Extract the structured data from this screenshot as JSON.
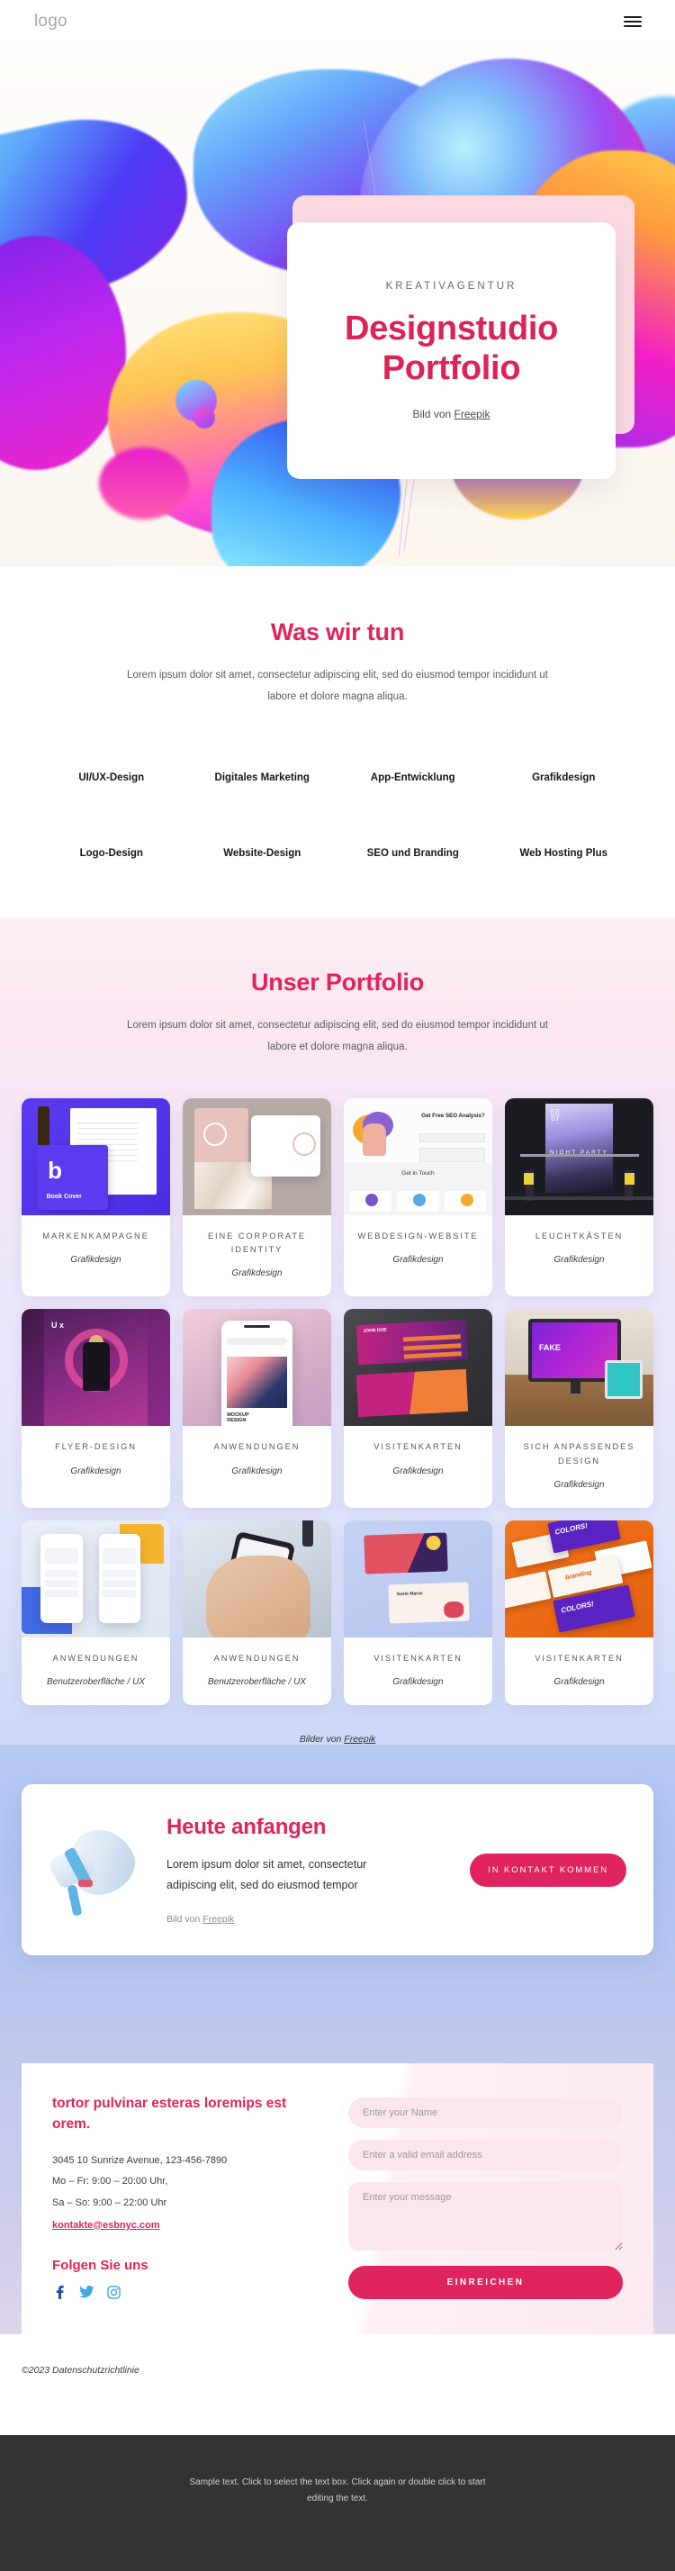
{
  "header": {
    "logo": "logo",
    "menu_icon": "hamburger-icon"
  },
  "hero": {
    "eyebrow": "KREATIVAGENTUR",
    "title_line1": "Designstudio",
    "title_line2": "Portfolio",
    "credit_prefix": "Bild von ",
    "credit_link": "Freepik"
  },
  "services": {
    "title": "Was wir tun",
    "subtitle": "Lorem ipsum dolor sit amet, consectetur adipiscing elit, sed do eiusmod tempor incididunt ut labore et dolore magna aliqua.",
    "items": [
      "UI/UX-Design",
      "Digitales Marketing",
      "App-Entwicklung",
      "Grafikdesign",
      "Logo-Design",
      "Website-Design",
      "SEO und Branding",
      "Web Hosting Plus"
    ]
  },
  "portfolio": {
    "title": "Unser Portfolio",
    "subtitle": "Lorem ipsum dolor sit amet, consectetur adipiscing elit, sed do eiusmod tempor incididunt ut labore et dolore magna aliqua.",
    "credit_prefix": "Bilder von ",
    "credit_link": "Freepik",
    "items": [
      {
        "title": "MARKENKAMPAGNE",
        "category": "Grafikdesign",
        "art": "t-brand"
      },
      {
        "title": "EINE CORPORATE IDENTITY",
        "category": "Grafikdesign",
        "art": "t-ci"
      },
      {
        "title": "WEBDESIGN-WEBSITE",
        "category": "Grafikdesign",
        "art": "t-web"
      },
      {
        "title": "LEUCHTKÄSTEN",
        "category": "Grafikdesign",
        "art": "t-light"
      },
      {
        "title": "FLYER-DESIGN",
        "category": "Grafikdesign",
        "art": "t-flyer"
      },
      {
        "title": "ANWENDUNGEN",
        "category": "Grafikdesign",
        "art": "t-app1"
      },
      {
        "title": "VISITENKARTEN",
        "category": "Grafikdesign",
        "art": "t-vis1"
      },
      {
        "title": "SICH ANPASSENDES DESIGN",
        "category": "Grafikdesign",
        "art": "t-resp"
      },
      {
        "title": "ANWENDUNGEN",
        "category": "Benutzeroberfläche / UX",
        "art": "t-app2"
      },
      {
        "title": "ANWENDUNGEN",
        "category": "Benutzeroberfläche / UX",
        "art": "t-hand"
      },
      {
        "title": "VISITENKARTEN",
        "category": "Grafikdesign",
        "art": "t-vis2"
      },
      {
        "title": "VISITENKARTEN",
        "category": "Grafikdesign",
        "art": "t-col"
      }
    ]
  },
  "cta": {
    "title": "Heute anfangen",
    "paragraph": "Lorem ipsum dolor sit amet, consectetur adipiscing elit, sed do eiusmod tempor",
    "credit_prefix": "Bild von ",
    "credit_link": "Freepik",
    "button": "IN KONTAKT KOMMEN",
    "icon": "megaphone-icon"
  },
  "contact": {
    "title": "tortor pulvinar esteras loremips est orem.",
    "address": "3045 10 Sunrize Avenue, 123-456-7890",
    "hours_1": "Mo – Fr: 9:00 – 20:00 Uhr,",
    "hours_2": "Sa – So: 9:00 – 22:00 Uhr",
    "email": "kontakte@esbnyc.com",
    "follow_title": "Folgen Sie uns",
    "socials": [
      "facebook-icon",
      "twitter-icon",
      "instagram-icon"
    ],
    "form": {
      "name_placeholder": "Enter your Name",
      "email_placeholder": "Enter a valid email address",
      "message_placeholder": "Enter your message",
      "submit": "EINREICHEN"
    }
  },
  "footer": {
    "copyright": "©2023 Datenschutzrichtlinie",
    "sample_text": "Sample text. Click to select the text box. Click again or double click to start editing the text."
  },
  "colors": {
    "accent": "#e0245e",
    "hero_title": "#dc2358",
    "dark_bar": "#333333",
    "input_bg": "#fce6ee"
  }
}
